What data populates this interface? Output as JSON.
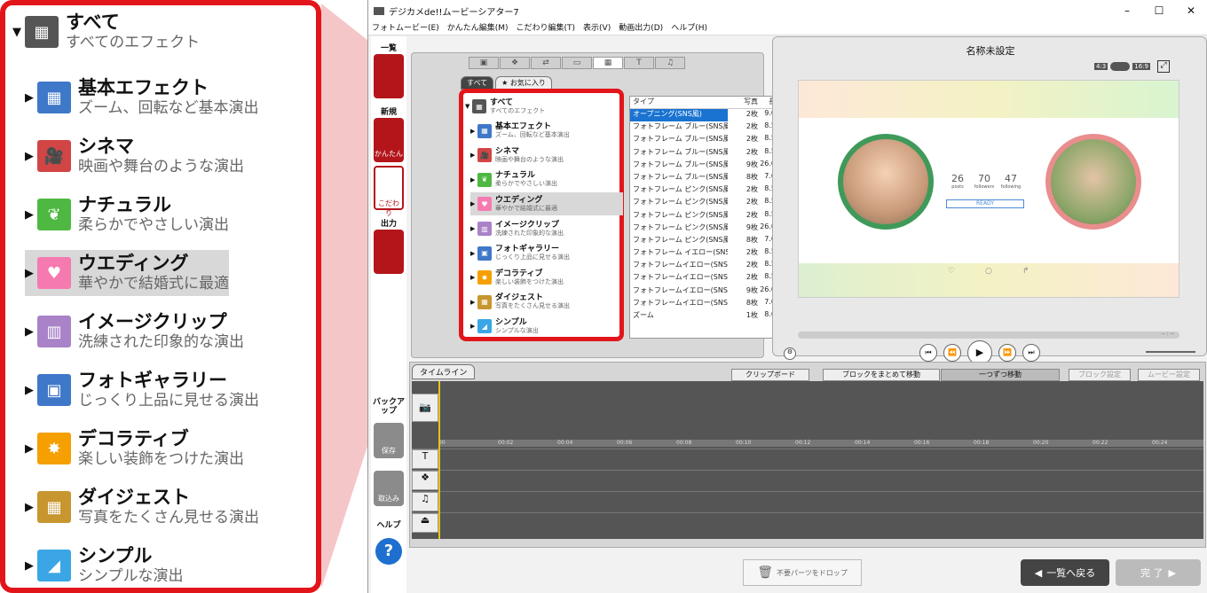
{
  "window": {
    "title": "デジカメde!!ムービーシアター7",
    "controls": [
      "–",
      "☐",
      "✕"
    ]
  },
  "menu": [
    "フォトムービー(E)",
    "かんたん編集(M)",
    "こだわり編集(T)",
    "表示(V)",
    "動画出力(D)",
    "ヘルプ(H)"
  ],
  "left_rail": {
    "section1": "一覧",
    "new_label": "新規",
    "easy_label": "かんたん",
    "detail_label": "こだわり",
    "output_label": "出力",
    "backup_label": "バックアップ",
    "save_label": "保存",
    "import_label": "取込み",
    "help_label": "ヘルプ"
  },
  "effects": {
    "subtabs": [
      "すべて",
      "★ お気に入り"
    ],
    "categories": [
      {
        "title": "すべて",
        "desc": "すべてのエフェクト",
        "color": "#555555",
        "icon": "all-icon"
      },
      {
        "title": "基本エフェクト",
        "desc": "ズーム、回転など基本演出",
        "color": "#3f78c8",
        "icon": "basic-effect-icon"
      },
      {
        "title": "シネマ",
        "desc": "映画や舞台のような演出",
        "color": "#d24545",
        "icon": "cinema-icon"
      },
      {
        "title": "ナチュラル",
        "desc": "柔らかでやさしい演出",
        "color": "#4fb842",
        "icon": "leaf-icon"
      },
      {
        "title": "ウエディング",
        "desc": "華やかで結婚式に最適",
        "color": "#f57ab0",
        "icon": "heart-icon"
      },
      {
        "title": "イメージクリップ",
        "desc": "洗練された印象的な演出",
        "color": "#a982c8",
        "icon": "image-clip-icon"
      },
      {
        "title": "フォトギャラリー",
        "desc": "じっくり上品に見せる演出",
        "color": "#3f78c8",
        "icon": "gallery-icon"
      },
      {
        "title": "デコラティブ",
        "desc": "楽しい装飾をつけた演出",
        "color": "#f5a000",
        "icon": "decorative-icon"
      },
      {
        "title": "ダイジェスト",
        "desc": "写真をたくさん見せる演出",
        "color": "#c8962f",
        "icon": "digest-icon"
      },
      {
        "title": "シンプル",
        "desc": "シンプルな演出",
        "color": "#3aa6e6",
        "icon": "simple-icon"
      }
    ],
    "list_headers": [
      "タイプ",
      "写真",
      "長"
    ],
    "list_rows": [
      [
        "オープニング(SNS風)",
        "2枚",
        "9.0"
      ],
      [
        "フォトフレーム ブルー(SNS風)",
        "2枚",
        "8.5"
      ],
      [
        "フォトフレーム ブルー(SNS風)",
        "2枚",
        "8.5"
      ],
      [
        "フォトフレーム ブルー(SNS風)",
        "2枚",
        "8.5"
      ],
      [
        "フォトフレーム ブルー(SNS風)",
        "9枚",
        "26.0"
      ],
      [
        "フォトフレーム ブルー(SNS風)",
        "8枚",
        "7.0"
      ],
      [
        "フォトフレーム ピンク(SNS風)",
        "2枚",
        "8.5"
      ],
      [
        "フォトフレーム ピンク(SNS風)",
        "2枚",
        "8.5"
      ],
      [
        "フォトフレーム ピンク(SNS風)",
        "2枚",
        "8.5"
      ],
      [
        "フォトフレーム ピンク(SNS風)",
        "9枚",
        "26.0"
      ],
      [
        "フォトフレーム ピンク(SNS風)",
        "8枚",
        "7.0"
      ],
      [
        "フォトフレーム イエロー(SNS風)",
        "2枚",
        "8.5"
      ],
      [
        "フォトフレームイエロー(SNS風)",
        "2枚",
        "8.5"
      ],
      [
        "フォトフレームイエロー(SNS風)",
        "2枚",
        "8.5"
      ],
      [
        "フォトフレームイエロー(SNS風)",
        "9枚",
        "26.0"
      ],
      [
        "フォトフレームイエロー(SNS風)",
        "8枚",
        "7.0"
      ],
      [
        "ズーム",
        "1枚",
        "8.0"
      ]
    ]
  },
  "preview": {
    "title": "名称未設定",
    "aspect_43": "4:3",
    "aspect_169": "16:9",
    "stats": [
      {
        "n": "26",
        "l": "posts"
      },
      {
        "n": "70",
        "l": "followers"
      },
      {
        "n": "47",
        "l": "following"
      }
    ],
    "ready": "READY",
    "time": "-- : --"
  },
  "timeline": {
    "tab": "タイムライン",
    "clipboard": "クリップボード",
    "block_move": "ブロックをまとめて移動",
    "single_move": "一つずつ移動",
    "block_settings": "ブロック設定",
    "movie_settings": "ムービー設定",
    "ticks": [
      "00",
      "00:02",
      "00:04",
      "00:06",
      "00:08",
      "00:10",
      "00:12",
      "00:14",
      "00:16",
      "00:18",
      "00:20",
      "00:22",
      "00:24"
    ]
  },
  "footer": {
    "drop": "不要パーツをドロップ",
    "back": "一覧へ戻る",
    "done": "完 了"
  }
}
